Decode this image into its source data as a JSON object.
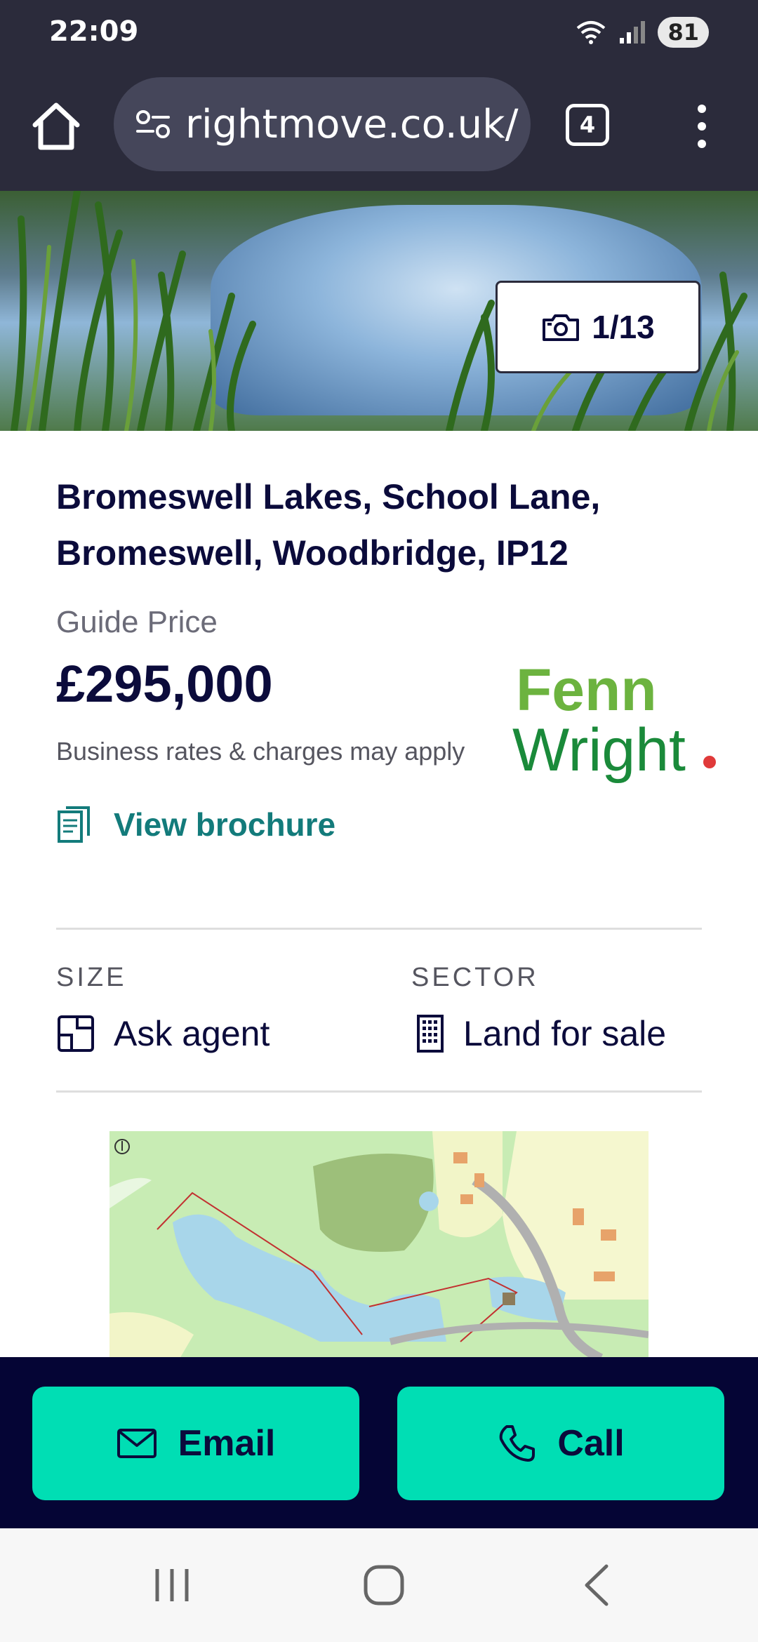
{
  "status_bar": {
    "time": "22:09",
    "battery": "81",
    "icons": [
      "wifi-icon",
      "signal-icon",
      "battery-icon"
    ]
  },
  "browser": {
    "url": "rightmove.co.uk/",
    "tab_count": "4",
    "icons": [
      "home-icon",
      "site-settings-icon",
      "tabs-icon",
      "more-vert-icon"
    ]
  },
  "gallery": {
    "counter": "1/13",
    "icon": "camera-icon"
  },
  "listing": {
    "address": "Bromeswell Lakes, School Lane, Bromeswell, Woodbridge, IP12",
    "price_label": "Guide Price",
    "price": "£295,000",
    "rates_note": "Business rates & charges may apply",
    "agent_logo_line1": "Fenn",
    "agent_logo_line2": "Wright",
    "brochure_label": "View brochure"
  },
  "details": {
    "size_label": "SIZE",
    "size_value": "Ask agent",
    "sector_label": "SECTOR",
    "sector_value": "Land for sale"
  },
  "actions": {
    "email_label": "Email",
    "call_label": "Call"
  },
  "colors": {
    "chrome": "#2b2b3b",
    "accent_teal": "#137b7b",
    "button_green": "#00deb4",
    "action_bar": "#050535",
    "logo_green_light": "#6cb33f",
    "logo_green_dark": "#1a8a3a"
  }
}
